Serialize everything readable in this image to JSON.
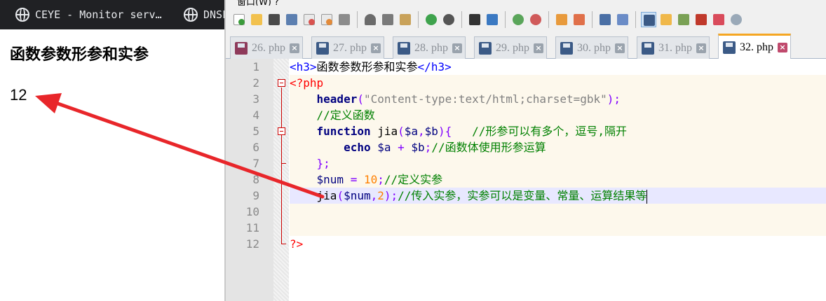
{
  "browser": {
    "tabs": [
      {
        "label": "CEYE - Monitor serv…",
        "icon": "globe-icon"
      },
      {
        "label": "DNSL",
        "icon": "globe-icon"
      }
    ],
    "page": {
      "heading": "函数参数形参和实参",
      "output": "12"
    }
  },
  "editor": {
    "menu_fragment": "窗口(W)  ?",
    "toolbar_icons": [
      "new-file-icon",
      "open-file-icon",
      "save-icon",
      "save-all-icon",
      "close-icon",
      "close-all-icon",
      "print-icon",
      "cut-icon",
      "copy-icon",
      "paste-icon",
      "undo-icon",
      "redo-icon",
      "find-icon",
      "replace-icon",
      "zoom-in-icon",
      "zoom-out-icon",
      "sync-v-icon",
      "sync-h-icon",
      "word-wrap-icon",
      "show-all-chars-icon",
      "indent-guide-icon",
      "user-lang-icon",
      "doc-map-icon",
      "function-list-icon",
      "folder-icon",
      "monitor-icon"
    ],
    "file_tabs": [
      {
        "label": "26. php",
        "active": false
      },
      {
        "label": "27. php",
        "active": false
      },
      {
        "label": "28. php",
        "active": false
      },
      {
        "label": "29. php",
        "active": false
      },
      {
        "label": "30. php",
        "active": false
      },
      {
        "label": "31. php",
        "active": false
      },
      {
        "label": "32. php",
        "active": true
      }
    ],
    "line_numbers": [
      "1",
      "2",
      "3",
      "4",
      "5",
      "6",
      "7",
      "8",
      "9",
      "10",
      "11",
      "12"
    ],
    "code": {
      "l1": {
        "open": "<h3>",
        "text": "函数参数形参和实参",
        "close": "</h3>"
      },
      "l2": {
        "tag": "<?php"
      },
      "l3": {
        "fn": "header",
        "p1": "(",
        "str": "\"Content-type:text/html;charset=gbk\"",
        "p2": ");"
      },
      "l4": {
        "cmt": "//定义函数"
      },
      "l5": {
        "kw": "function",
        "name": " jia",
        "p1": "(",
        "a": "$a",
        "comma": ",",
        "b": "$b",
        "p2": "){",
        "cmt": "   //形参可以有多个，逗号,隔开"
      },
      "l6": {
        "kw": "echo",
        "a": " $a",
        "op": " + ",
        "b": "$b",
        "semi": ";",
        "cmt": "//函数体使用形参运算"
      },
      "l7": {
        "p": "};"
      },
      "l8": {
        "var": "$num",
        "op": " = ",
        "num": "10",
        "semi": ";",
        "cmt": "//定义实参"
      },
      "l9": {
        "name": "jia",
        "p1": "(",
        "var": "$num",
        "comma": ",",
        "num": "2",
        "p2": ");",
        "cmt": "//传入实参，实参可以是变量、常量、运算结果等"
      },
      "l12": {
        "tag": "?>"
      }
    }
  },
  "colors": {
    "annotation_arrow": "#e8262a",
    "tab_active_accent": "#f5a623",
    "browser_tabbar": "#202124"
  }
}
